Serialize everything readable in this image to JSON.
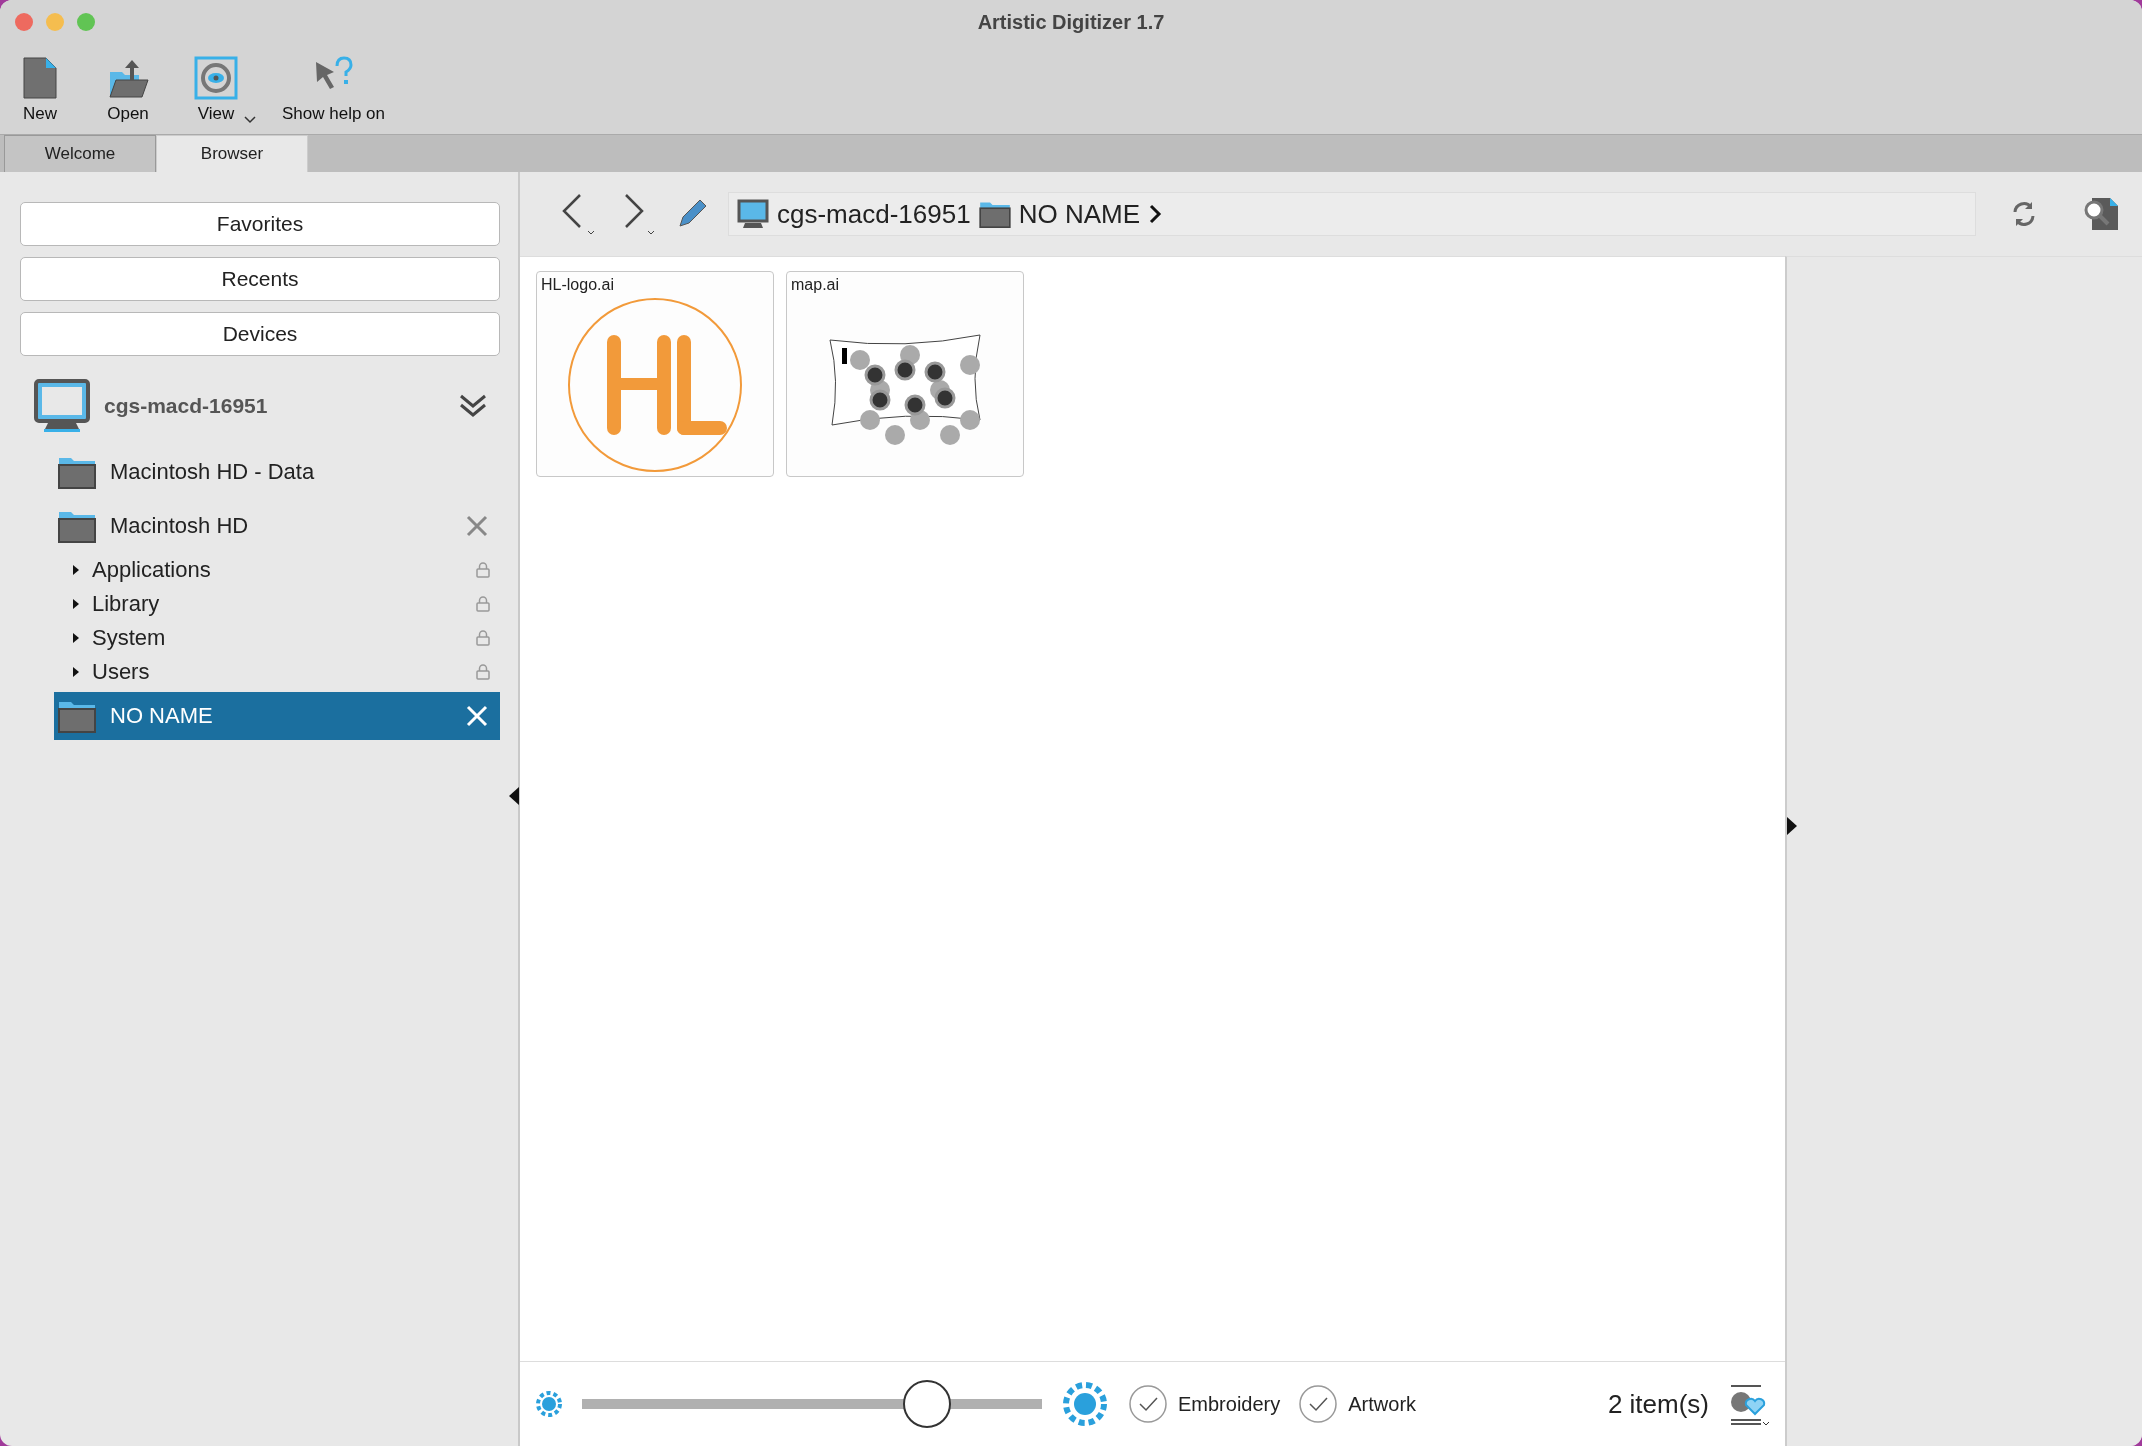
{
  "window": {
    "title": "Artistic Digitizer 1.7"
  },
  "toolbar": [
    {
      "label": "New",
      "kind": "new"
    },
    {
      "label": "Open",
      "kind": "open"
    },
    {
      "label": "View",
      "kind": "view"
    },
    {
      "label": "Show help on",
      "kind": "help"
    }
  ],
  "tabs": [
    {
      "label": "Welcome",
      "selected": false
    },
    {
      "label": "Browser",
      "selected": true
    }
  ],
  "sidebar": {
    "buttons": [
      "Favorites",
      "Recents",
      "Devices"
    ],
    "device": {
      "name": "cgs-macd-16951",
      "expanded": true,
      "volumes": [
        {
          "name": "Macintosh HD - Data",
          "removable": false,
          "selected": false
        },
        {
          "name": "Macintosh HD",
          "removable": true,
          "selected": false,
          "children": [
            {
              "name": "Applications",
              "locked": true
            },
            {
              "name": "Library",
              "locked": true
            },
            {
              "name": "System",
              "locked": true
            },
            {
              "name": "Users",
              "locked": true
            }
          ]
        },
        {
          "name": "NO NAME",
          "removable": true,
          "selected": true
        }
      ]
    }
  },
  "breadcrumb": [
    {
      "name": "cgs-macd-16951",
      "kind": "computer"
    },
    {
      "name": "NO NAME",
      "kind": "folder"
    }
  ],
  "files": [
    {
      "name": "HL-logo.ai",
      "kind": "logo"
    },
    {
      "name": "map.ai",
      "kind": "map"
    }
  ],
  "bottom_bar": {
    "zoom": {
      "level": 0.75
    },
    "filters": [
      {
        "label": "Embroidery",
        "checked": true
      },
      {
        "label": "Artwork",
        "checked": true
      }
    ],
    "count": "2 item(s)"
  }
}
